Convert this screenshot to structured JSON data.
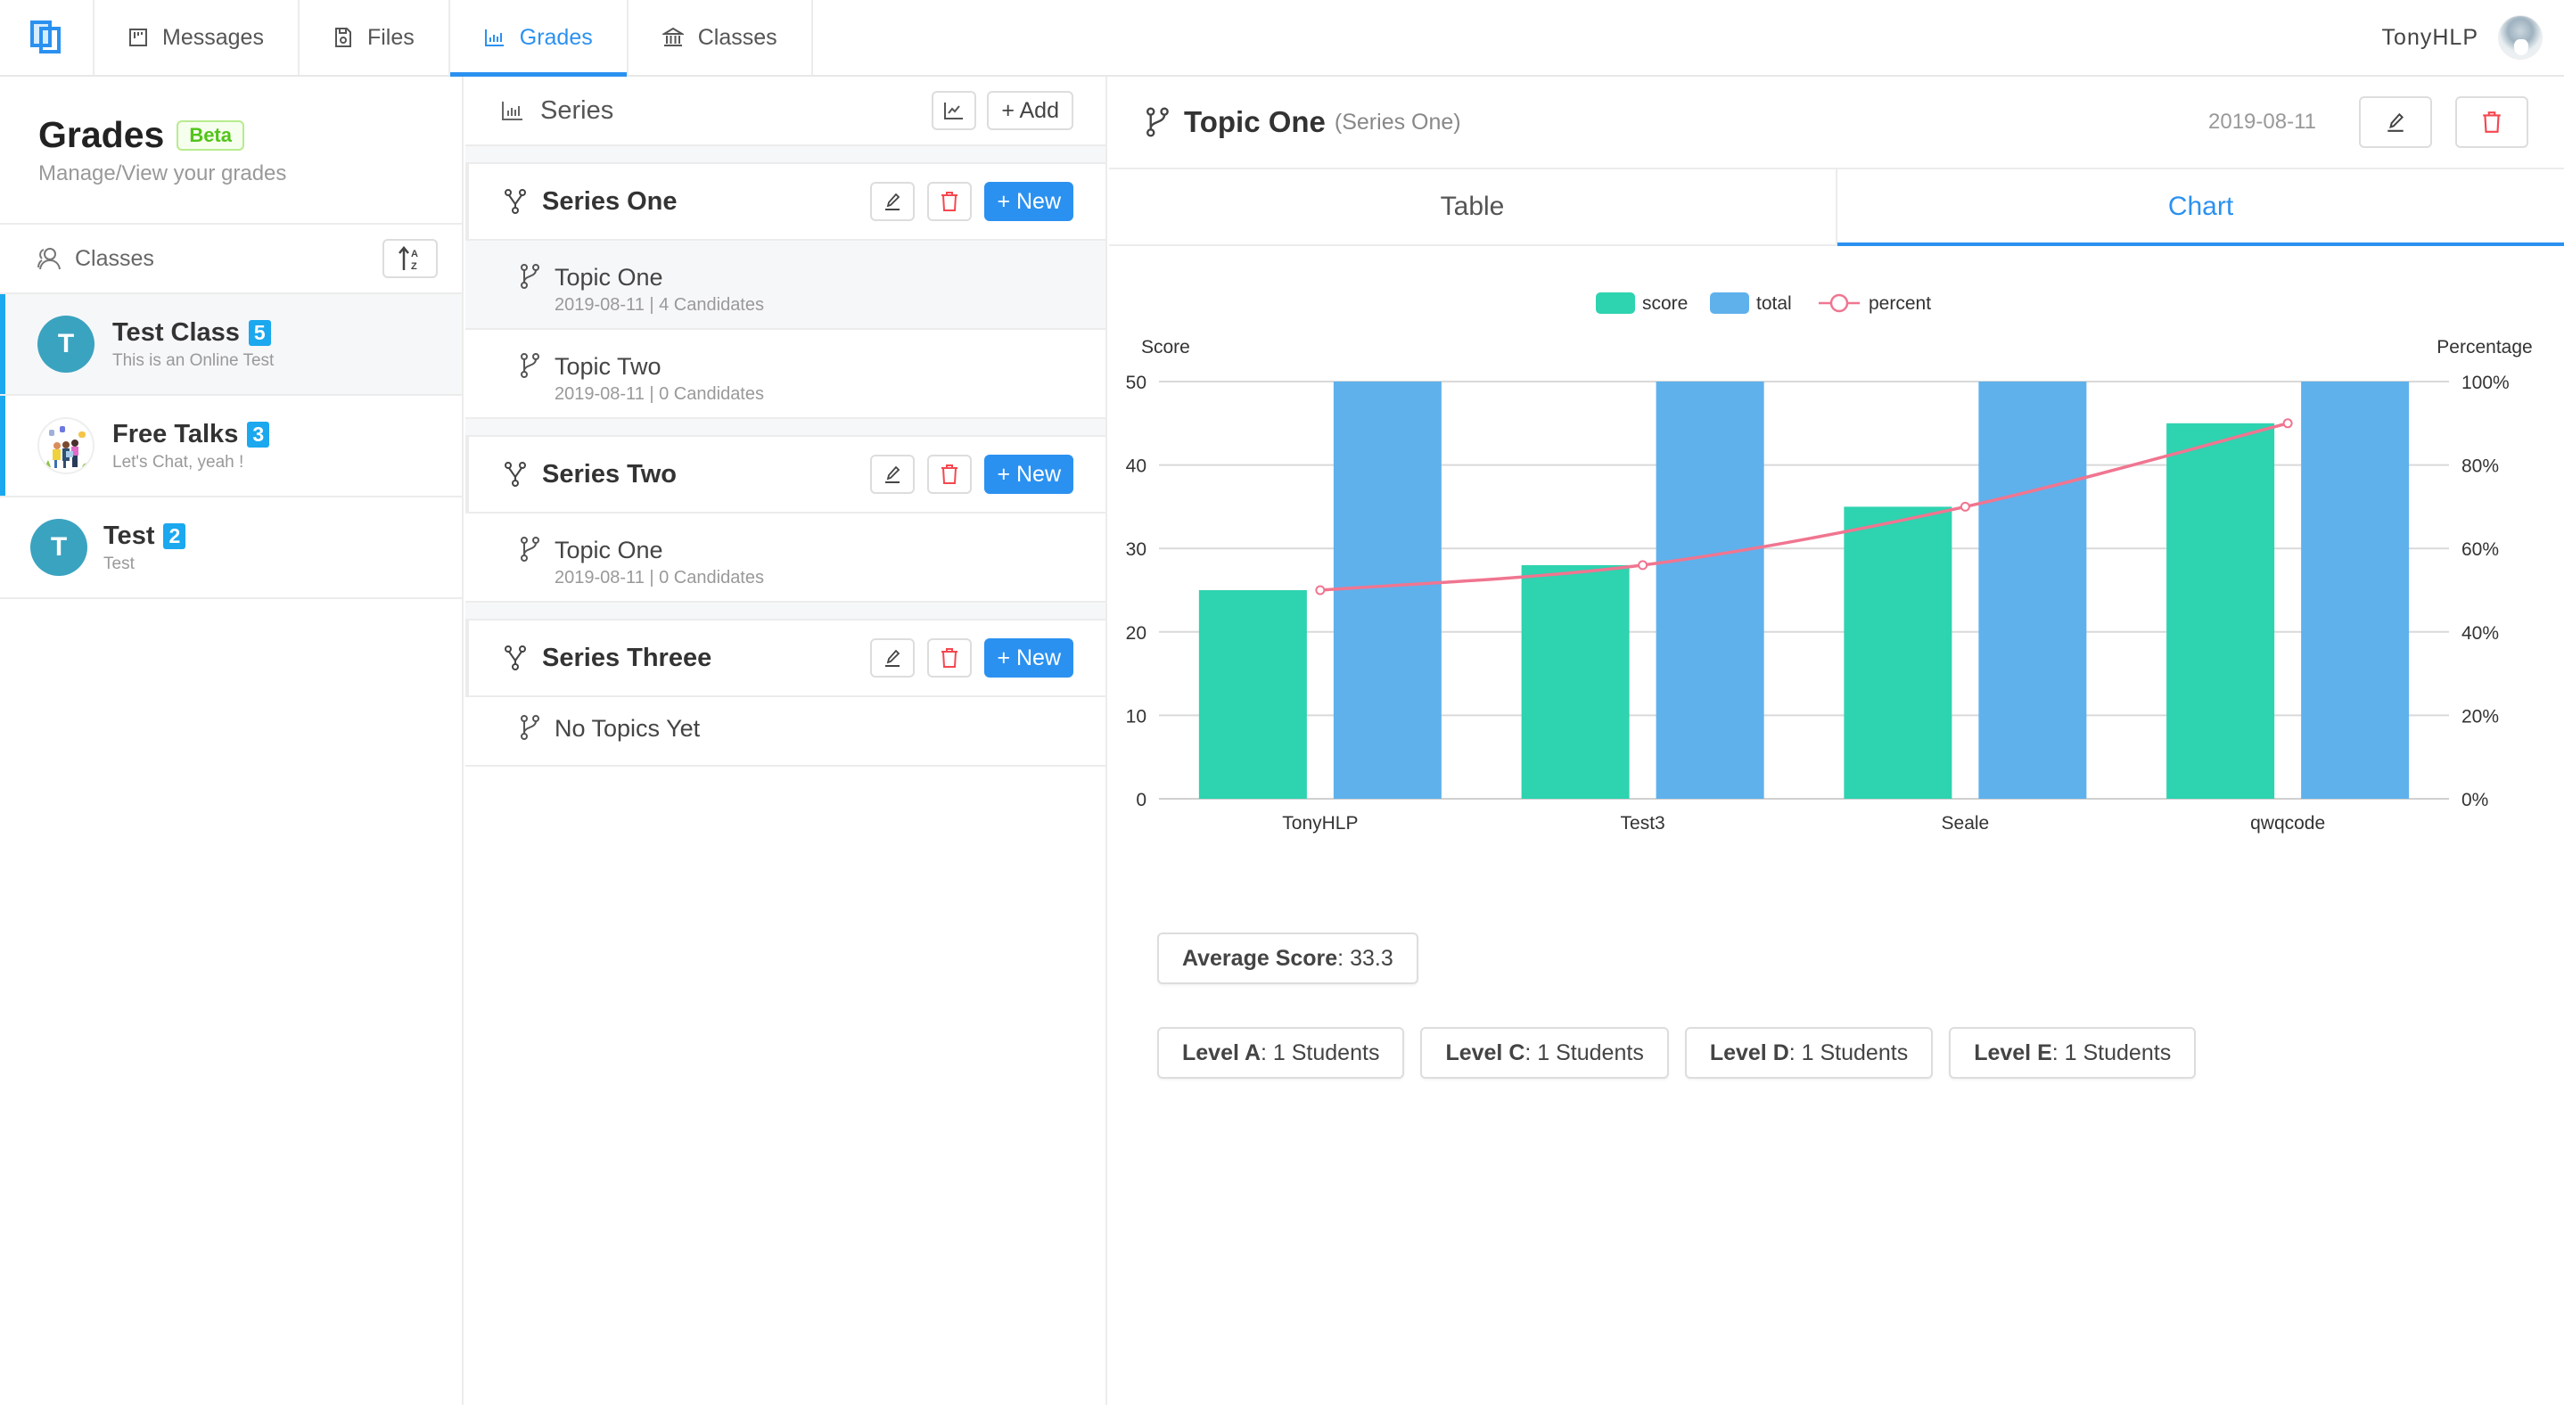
{
  "nav": {
    "logo": "app-logo",
    "tabs": [
      {
        "label": "Messages",
        "icon": "board-icon",
        "active": false
      },
      {
        "label": "Files",
        "icon": "save-icon",
        "active": false
      },
      {
        "label": "Grades",
        "icon": "bar-chart-icon",
        "active": true
      },
      {
        "label": "Classes",
        "icon": "bank-icon",
        "active": false
      }
    ],
    "username": "TonyHLP"
  },
  "left": {
    "title": "Grades",
    "badge": "Beta",
    "subtitle": "Manage/View your grades",
    "classes_label": "Classes",
    "classes": [
      {
        "name": "Test Class",
        "count": "5",
        "desc": "This is an Online Test",
        "avatar_letter": "T",
        "selected": true
      },
      {
        "name": "Free Talks",
        "count": "3",
        "desc": "Let's Chat, yeah !",
        "avatar_letter": "",
        "selected": false
      },
      {
        "name": "Test",
        "count": "2",
        "desc": "Test",
        "avatar_letter": "T",
        "selected": false
      }
    ]
  },
  "middle": {
    "title": "Series",
    "add_label": "+ Add",
    "new_label": "+ New",
    "series": [
      {
        "name": "Series One",
        "topics": [
          {
            "name": "Topic One",
            "meta": "2019-08-11 | 4 Candidates",
            "selected": true
          },
          {
            "name": "Topic Two",
            "meta": "2019-08-11 | 0 Candidates",
            "selected": false
          }
        ]
      },
      {
        "name": "Series Two",
        "topics": [
          {
            "name": "Topic One",
            "meta": "2019-08-11 | 0 Candidates",
            "selected": false
          }
        ]
      },
      {
        "name": "Series Threee",
        "topics": [],
        "empty_label": "No Topics Yet"
      }
    ]
  },
  "right": {
    "title": "Topic One",
    "subtitle": "(Series One)",
    "date": "2019-08-11",
    "tabs": [
      {
        "label": "Table",
        "active": false
      },
      {
        "label": "Chart",
        "active": true
      }
    ],
    "average": {
      "label": "Average Score",
      "value": ": 33.3"
    },
    "levels": [
      {
        "label": "Level A",
        "value": ": 1 Students"
      },
      {
        "label": "Level C",
        "value": ": 1 Students"
      },
      {
        "label": "Level D",
        "value": ": 1 Students"
      },
      {
        "label": "Level E",
        "value": ": 1 Students"
      }
    ]
  },
  "colors": {
    "accent": "#2b91f0",
    "badge": "#1ba8ee",
    "score": "#2ed3b0",
    "total": "#5fb1ec",
    "percent": "#f07590",
    "danger": "#f5474f"
  },
  "chart_data": {
    "type": "bar",
    "categories": [
      "TonyHLP",
      "Test3",
      "Seale",
      "qwqcode"
    ],
    "series": [
      {
        "name": "score",
        "type": "bar",
        "axis": "left",
        "values": [
          25,
          28,
          35,
          45
        ]
      },
      {
        "name": "total",
        "type": "bar",
        "axis": "left",
        "values": [
          50,
          50,
          50,
          50
        ]
      },
      {
        "name": "percent",
        "type": "line",
        "axis": "right",
        "values": [
          50,
          56,
          70,
          90
        ]
      }
    ],
    "ylabel": "Score",
    "ylabel_right": "Percentage",
    "ylim": [
      0,
      50
    ],
    "yticks": [
      "0",
      "10",
      "20",
      "30",
      "40",
      "50"
    ],
    "ylim_right": [
      0,
      100
    ],
    "yticks_right": [
      "0%",
      "20%",
      "40%",
      "60%",
      "80%",
      "100%"
    ],
    "legend": [
      "score",
      "total",
      "percent"
    ],
    "legend_position": "top-center",
    "grid": true
  }
}
